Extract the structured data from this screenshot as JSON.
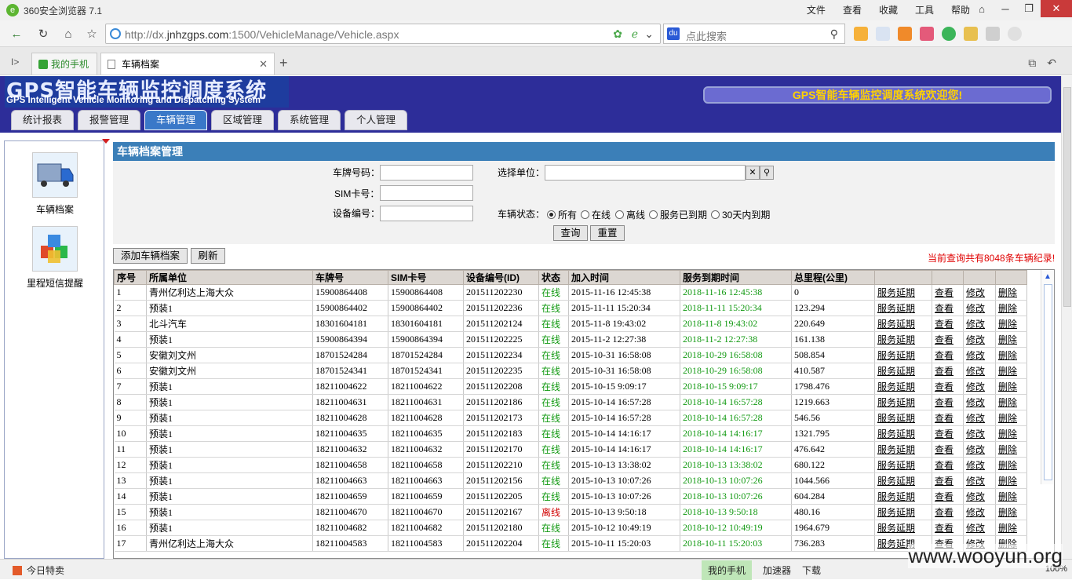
{
  "browser": {
    "app_title": "360安全浏览器 7.1",
    "menu": [
      "文件",
      "查看",
      "收藏",
      "工具",
      "帮助"
    ],
    "url_prefix": "http://dx.",
    "url_domain": "jnhzgps.com",
    "url_rest": ":1500/VehicleManage/Vehicle.aspx",
    "search_placeholder": "点此搜索",
    "tabs": [
      {
        "label": "我的手机"
      },
      {
        "label": "车辆档案"
      }
    ],
    "status_left": "今日特卖",
    "status_items": [
      "我的手机",
      "加速器",
      "下载"
    ],
    "zoom": "100%",
    "watermark": "www.wooyun.org"
  },
  "app": {
    "title_cn": "GPS智能车辆监控调度系统",
    "title_en": "GPS Intelligent Vehicle Monitoring and Dispatching System",
    "welcome": "GPS智能车辆监控调度系统欢迎您!",
    "nav_tabs": [
      "统计报表",
      "报警管理",
      "车辆管理",
      "区域管理",
      "系统管理",
      "个人管理"
    ],
    "active_tab": "车辆管理",
    "side_items": [
      "车辆档案",
      "里程短信提醒"
    ]
  },
  "panel": {
    "title": "车辆档案管理",
    "plate_label": "车牌号码：",
    "sim_label": "SIM卡号：",
    "device_label": "设备编号：",
    "unit_label": "选择单位：",
    "status_label": "车辆状态：",
    "status_options": [
      "所有",
      "在线",
      "离线",
      "服务已到期",
      "30天内到期"
    ],
    "status_selected": "所有",
    "query_btn": "查询",
    "reset_btn": "重置",
    "add_btn": "添加车辆档案",
    "refresh_btn": "刷新",
    "count_text": "当前查询共有8048条车辆纪录!"
  },
  "table": {
    "headers": [
      "序号",
      "所属单位",
      "车牌号",
      "SIM卡号",
      "设备编号(ID)",
      "状态",
      "加入时间",
      "服务到期时间",
      "总里程(公里)",
      "",
      "",
      "",
      ""
    ],
    "ops": [
      "服务延期",
      "查看",
      "修改",
      "删除"
    ],
    "rows": [
      [
        "1",
        "青州亿利达上海大众",
        "15900864408",
        "15900864408",
        "201511202230",
        "在线",
        "2015-11-16 12:45:38",
        "2018-11-16 12:45:38",
        "0"
      ],
      [
        "2",
        "预装1",
        "15900864402",
        "15900864402",
        "201511202236",
        "在线",
        "2015-11-11 15:20:34",
        "2018-11-11 15:20:34",
        "123.294"
      ],
      [
        "3",
        "北斗汽车",
        "18301604181",
        "18301604181",
        "201511202124",
        "在线",
        "2015-11-8 19:43:02",
        "2018-11-8 19:43:02",
        "220.649"
      ],
      [
        "4",
        "预装1",
        "15900864394",
        "15900864394",
        "201511202225",
        "在线",
        "2015-11-2 12:27:38",
        "2018-11-2 12:27:38",
        "161.138"
      ],
      [
        "5",
        "安徽刘文州",
        "18701524284",
        "18701524284",
        "201511202234",
        "在线",
        "2015-10-31 16:58:08",
        "2018-10-29 16:58:08",
        "508.854"
      ],
      [
        "6",
        "安徽刘文州",
        "18701524341",
        "18701524341",
        "201511202235",
        "在线",
        "2015-10-31 16:58:08",
        "2018-10-29 16:58:08",
        "410.587"
      ],
      [
        "7",
        "预装1",
        "18211004622",
        "18211004622",
        "201511202208",
        "在线",
        "2015-10-15 9:09:17",
        "2018-10-15 9:09:17",
        "1798.476"
      ],
      [
        "8",
        "预装1",
        "18211004631",
        "18211004631",
        "201511202186",
        "在线",
        "2015-10-14 16:57:28",
        "2018-10-14 16:57:28",
        "1219.663"
      ],
      [
        "9",
        "预装1",
        "18211004628",
        "18211004628",
        "201511202173",
        "在线",
        "2015-10-14 16:57:28",
        "2018-10-14 16:57:28",
        "546.56"
      ],
      [
        "10",
        "预装1",
        "18211004635",
        "18211004635",
        "201511202183",
        "在线",
        "2015-10-14 14:16:17",
        "2018-10-14 14:16:17",
        "1321.795"
      ],
      [
        "11",
        "预装1",
        "18211004632",
        "18211004632",
        "201511202170",
        "在线",
        "2015-10-14 14:16:17",
        "2018-10-14 14:16:17",
        "476.642"
      ],
      [
        "12",
        "预装1",
        "18211004658",
        "18211004658",
        "201511202210",
        "在线",
        "2015-10-13 13:38:02",
        "2018-10-13 13:38:02",
        "680.122"
      ],
      [
        "13",
        "预装1",
        "18211004663",
        "18211004663",
        "201511202156",
        "在线",
        "2015-10-13 10:07:26",
        "2018-10-13 10:07:26",
        "1044.566"
      ],
      [
        "14",
        "预装1",
        "18211004659",
        "18211004659",
        "201511202205",
        "在线",
        "2015-10-13 10:07:26",
        "2018-10-13 10:07:26",
        "604.284"
      ],
      [
        "15",
        "预装1",
        "18211004670",
        "18211004670",
        "201511202167",
        "离线",
        "2015-10-13 9:50:18",
        "2018-10-13 9:50:18",
        "480.16"
      ],
      [
        "16",
        "预装1",
        "18211004682",
        "18211004682",
        "201511202180",
        "在线",
        "2015-10-12 10:49:19",
        "2018-10-12 10:49:19",
        "1964.679"
      ],
      [
        "17",
        "青州亿利达上海大众",
        "18211004583",
        "18211004583",
        "201511202204",
        "在线",
        "2015-10-11 15:20:03",
        "2018-10-11 15:20:03",
        "736.283"
      ]
    ]
  },
  "colors": {
    "header_bg": "#2d2d99",
    "panel_head": "#3b7fb8",
    "online": "#119911",
    "offline": "#d00000",
    "count_red": "#e00000",
    "welcome_text": "#ffd200"
  }
}
